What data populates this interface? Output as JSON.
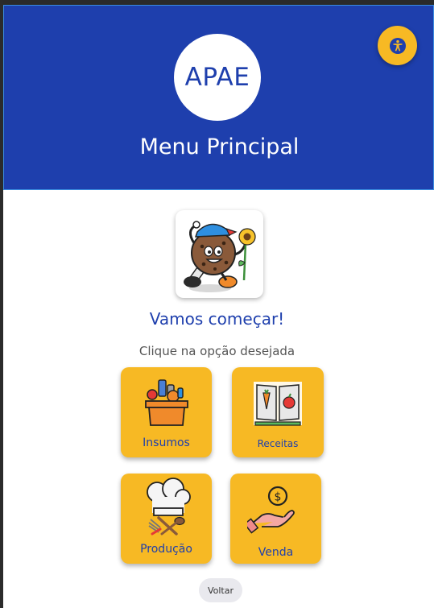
{
  "header": {
    "logo_text": "APAE",
    "title": "Menu Principal",
    "accessibility_icon": "accessibility-icon"
  },
  "main": {
    "mascot_icon": "cookie-mascot-icon",
    "welcome": "Vamos começar!",
    "instruction": "Clique na opção desejada",
    "options": [
      {
        "label": "Insumos",
        "icon": "groceries-box-icon"
      },
      {
        "label": "Receitas",
        "icon": "recipe-book-icon"
      },
      {
        "label": "Produção",
        "icon": "chef-hat-icon"
      },
      {
        "label": "Venda",
        "icon": "hand-coin-icon"
      }
    ],
    "back_label": "Voltar"
  },
  "colors": {
    "primary": "#1e3fad",
    "accent": "#f7b924",
    "background": "#ffffff"
  }
}
